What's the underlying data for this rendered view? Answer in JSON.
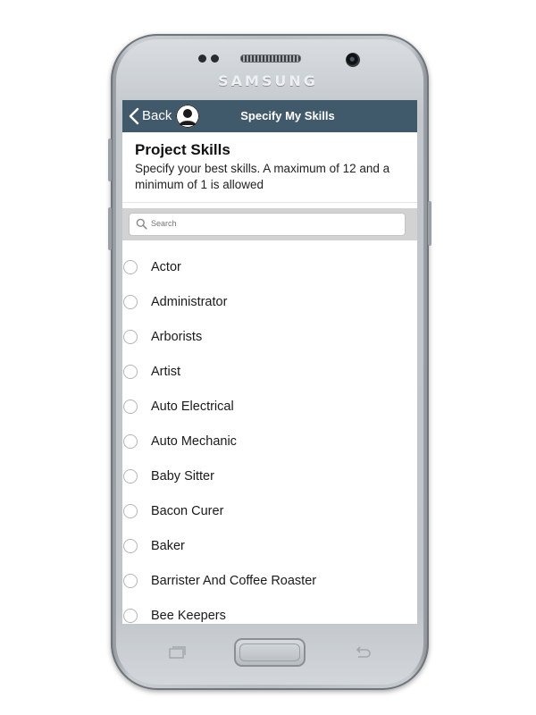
{
  "device": {
    "brand": "SAMSUNG"
  },
  "topbar": {
    "back_label": "Back",
    "title": "Specify My Skills",
    "bar_color": "#415a6b"
  },
  "section": {
    "title": "Project Skills",
    "description": "Specify your best skills. A maximum of 12 and a minimum of 1 is allowed"
  },
  "search": {
    "placeholder": "Search",
    "value": ""
  },
  "skills": [
    {
      "label": "Actor",
      "selected": false
    },
    {
      "label": "Administrator",
      "selected": false
    },
    {
      "label": "Arborists",
      "selected": false
    },
    {
      "label": "Artist",
      "selected": false
    },
    {
      "label": "Auto Electrical",
      "selected": false
    },
    {
      "label": "Auto Mechanic",
      "selected": false
    },
    {
      "label": "Baby Sitter",
      "selected": false
    },
    {
      "label": "Bacon Curer",
      "selected": false
    },
    {
      "label": "Baker",
      "selected": false
    },
    {
      "label": "Barrister And Coffee Roaster",
      "selected": false
    },
    {
      "label": "Bee Keepers",
      "selected": false
    }
  ],
  "icons": {
    "back": "chevron-left-icon",
    "avatar": "user-avatar-icon",
    "search": "search-icon",
    "recents": "recent-apps-icon",
    "nav_back": "back-arrow-icon"
  }
}
